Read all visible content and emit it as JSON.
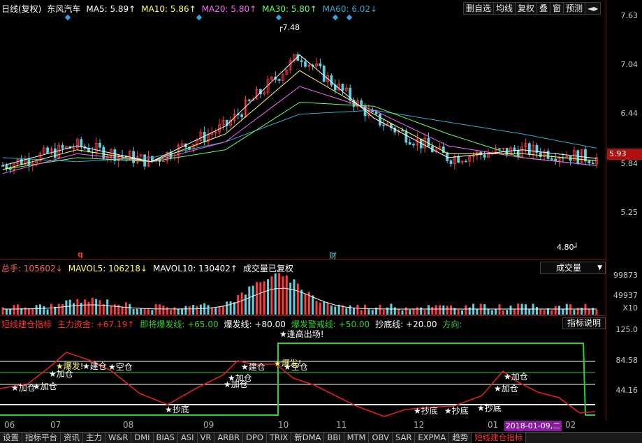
{
  "header": {
    "period": "日线(复权)",
    "stock": "东风汽车",
    "ma5": "MA5: 5.89↑",
    "ma10": "MA10: 5.86↑",
    "ma20": "MA20: 5.80↑",
    "ma30": "MA30: 5.80↑",
    "ma60": "MA60: 6.02↓"
  },
  "toolbar": {
    "b1": "删自选",
    "b2": "均线",
    "b3": "复权",
    "b4": "叠",
    "b5": "窗",
    "b6": "预测",
    "b7": "◄▸"
  },
  "price_axis": [
    "7.63",
    "7.04",
    "6.44",
    "5.84",
    "5.25"
  ],
  "current_price": "5.93",
  "annotations": {
    "high": "7.48",
    "low": "4.80",
    "marker_q": "q",
    "marker_cai": "财"
  },
  "volume": {
    "label_total": "总手: 105602↓",
    "label_m5": "MAVOL5: 106218↓",
    "label_m10": "MAVOL10: 130402↑",
    "note": "成交量已复权",
    "dropdown": "成交量",
    "axis": [
      "99873",
      "49937",
      "X10"
    ]
  },
  "indicator": {
    "name": "短线建仓指标",
    "f1": "主力资金: +67.19↑",
    "f2": "即将爆发线: +65.00",
    "f3": "爆发线: +80.00",
    "f4": "爆发警戒线: +50.00",
    "f5": "抄底线: +20.00",
    "f6": "方向:",
    "button": "指标说明",
    "axis": [
      "125.0",
      "84.58",
      "44.16"
    ],
    "signals": {
      "top": "★逢高出场!",
      "jc": "★加仓",
      "cd": "★抄底",
      "bf": "★爆发!",
      "qc": "★建仓",
      "kc": "★空仓"
    }
  },
  "date_axis": [
    "06",
    "07",
    "08",
    "09",
    "10",
    "11",
    "12",
    "01",
    "02"
  ],
  "cursor_date": "2018-01-09,二",
  "tabs": [
    "设置",
    "指标平台",
    "资讯",
    "主力",
    "W&R",
    "DMI",
    "BIAS",
    "ASI",
    "VR",
    "ARBR",
    "DPO",
    "TRIX",
    "新DMA",
    "BBI",
    "MTM",
    "OBV",
    "SAR",
    "EXPMA",
    "趋势",
    "短线建仓指标"
  ],
  "colors": {
    "up": "#ff3b3b",
    "down": "#5fd0e0",
    "ma5": "#ffffff",
    "ma10": "#ffff66",
    "ma20": "#ff66ff",
    "ma30": "#66ff66",
    "ma60": "#33aacc",
    "green_line": "#33cc33"
  },
  "chart_data": {
    "type": "line",
    "x": [
      "06",
      "07",
      "08",
      "09",
      "10",
      "11",
      "12",
      "01",
      "02"
    ],
    "series": [
      {
        "name": "MA60",
        "values": [
          5.9,
          5.85,
          5.9,
          6.1,
          6.45,
          6.5,
          6.35,
          6.2,
          6.02
        ]
      },
      {
        "name": "MA30",
        "values": [
          5.75,
          5.9,
          5.85,
          6.0,
          6.6,
          6.55,
          6.2,
          5.9,
          5.8
        ]
      },
      {
        "name": "MA20",
        "values": [
          5.7,
          5.95,
          5.85,
          6.1,
          6.8,
          6.5,
          6.05,
          5.9,
          5.8
        ]
      },
      {
        "name": "MA10",
        "values": [
          5.75,
          6.0,
          5.85,
          6.2,
          7.0,
          6.45,
          5.95,
          5.95,
          5.86
        ]
      },
      {
        "name": "MA5",
        "values": [
          5.8,
          6.05,
          5.85,
          6.3,
          7.2,
          6.4,
          5.9,
          6.0,
          5.89
        ]
      }
    ],
    "ylim": [
      4.7,
      7.7
    ]
  }
}
